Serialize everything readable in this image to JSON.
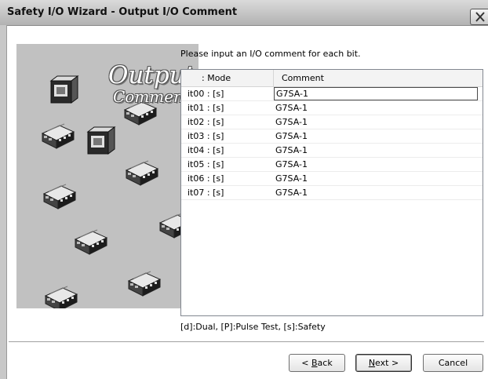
{
  "window": {
    "title": "Safety I/O Wizard - Output I/O Comment"
  },
  "picture": {
    "title_line1": "Output",
    "title_line2": "Comment"
  },
  "instruction": "Please input an I/O comment for each bit.",
  "table": {
    "columns": [
      ": Mode",
      "Comment"
    ],
    "rows": [
      {
        "mode": "it00 : [s]",
        "comment": "G7SA-1"
      },
      {
        "mode": "it01 : [s]",
        "comment": "G7SA-1"
      },
      {
        "mode": "it02 : [s]",
        "comment": "G7SA-1"
      },
      {
        "mode": "it03 : [s]",
        "comment": "G7SA-1"
      },
      {
        "mode": "it04 : [s]",
        "comment": "G7SA-1"
      },
      {
        "mode": "it05 : [s]",
        "comment": "G7SA-1"
      },
      {
        "mode": "it06 : [s]",
        "comment": "G7SA-1"
      },
      {
        "mode": "it07 : [s]",
        "comment": "G7SA-1"
      }
    ]
  },
  "legend": "[d]:Dual, [P]:Pulse Test, [s]:Safety",
  "buttons": {
    "back": {
      "prefix": "< ",
      "mnemonic": "B",
      "rest": "ack"
    },
    "next": {
      "prefix": "",
      "mnemonic": "N",
      "rest": "ext >"
    },
    "cancel": "Cancel"
  },
  "icons": {
    "close": "close-icon",
    "device": "io-module-icon"
  }
}
